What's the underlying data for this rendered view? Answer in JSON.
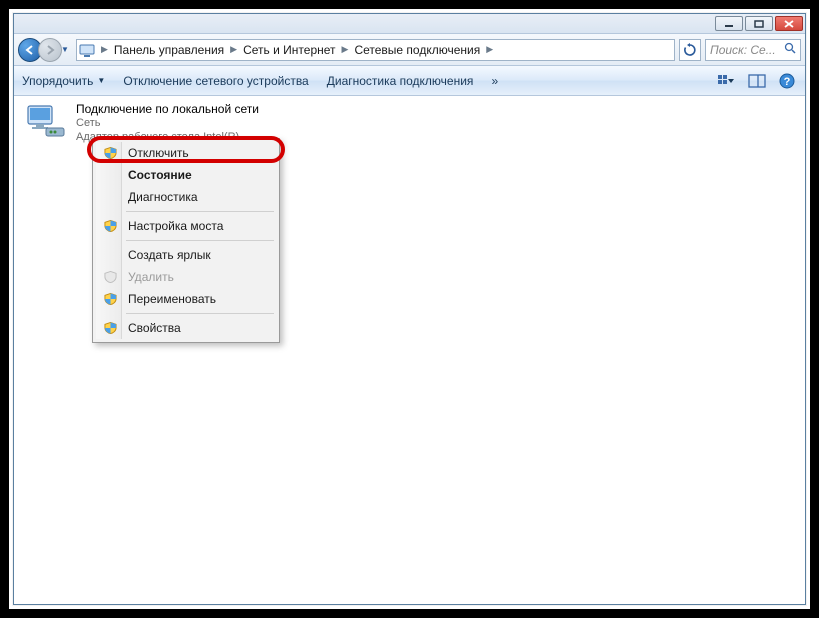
{
  "titlebar": {
    "minimize_tip": "Свернуть",
    "maximize_tip": "Развернуть",
    "close_tip": "Закрыть"
  },
  "nav": {
    "back_tip": "Назад",
    "forward_tip": "Вперед",
    "refresh_tip": "Обновить"
  },
  "breadcrumbs": {
    "0": "Панель управления",
    "1": "Сеть и Интернет",
    "2": "Сетевые подключения"
  },
  "search": {
    "placeholder": "Поиск: Се..."
  },
  "toolbar": {
    "organize": "Упорядочить",
    "disable_device": "Отключение сетевого устройства",
    "diagnose": "Диагностика подключения",
    "more": "»"
  },
  "connection": {
    "title": "Подключение по локальной сети",
    "sub1": "Сеть",
    "sub2": "Адаптер рабочего стола Intel(R)"
  },
  "ctx": {
    "disable": "Отключить",
    "status": "Состояние",
    "diagnose": "Диагностика",
    "bridge": "Настройка моста",
    "shortcut": "Создать ярлык",
    "delete": "Удалить",
    "rename": "Переименовать",
    "properties": "Свойства"
  }
}
